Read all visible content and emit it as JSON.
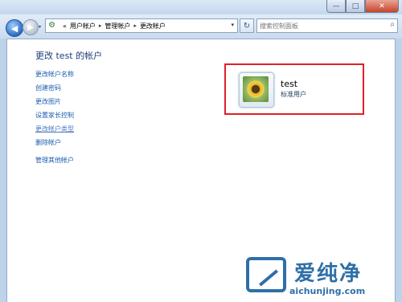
{
  "window": {
    "minimize_glyph": "—",
    "maximize_glyph": "□",
    "close_glyph": "✕"
  },
  "nav": {
    "back_glyph": "◀",
    "forward_glyph": "▶",
    "recent_glyph": "▾",
    "breadcrumb_prefix": "«",
    "breadcrumbs": [
      "用户帐户",
      "管理帐户",
      "更改帐户"
    ],
    "separator": "▸",
    "address_dropdown_glyph": "▾",
    "refresh_glyph": "↻",
    "search_placeholder": "搜索控制面板",
    "search_glyph": "⌕"
  },
  "main": {
    "title": "更改 test 的帐户",
    "links": [
      {
        "label": "更改帐户名称"
      },
      {
        "label": "创建密码"
      },
      {
        "label": "更改图片"
      },
      {
        "label": "设置家长控制"
      },
      {
        "label": "更改帐户类型"
      },
      {
        "label": "删除帐户"
      },
      {
        "label": "管理其他帐户"
      }
    ]
  },
  "account": {
    "name": "test",
    "type": "标准用户"
  },
  "watermark": {
    "brand": "爱纯净",
    "url": "aichunjing.com"
  }
}
